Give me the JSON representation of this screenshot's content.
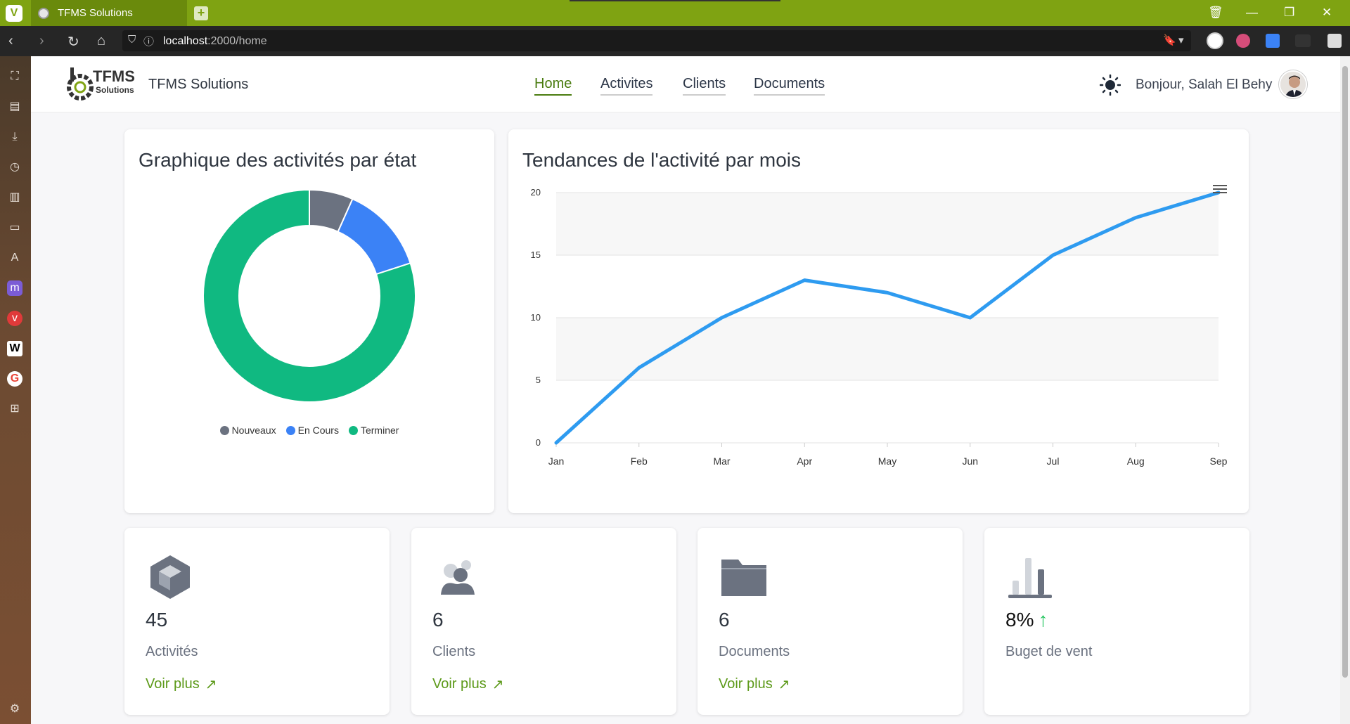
{
  "browser": {
    "tab_title": "TFMS Solutions",
    "url_host": "localhost",
    "url_path": ":2000/home"
  },
  "header": {
    "brand": "TFMS Solutions",
    "logo_text_top": "TFMS",
    "logo_text_bottom": "Solutions",
    "nav": [
      "Home",
      "Activites",
      "Clients",
      "Documents"
    ],
    "active_nav": "Home",
    "greeting": "Bonjour, Salah El Behy"
  },
  "donut": {
    "title": "Graphique des activités par état",
    "legend": [
      "Nouveaux",
      "En Cours",
      "Terminer"
    ]
  },
  "line": {
    "title": "Tendances de l'activité par mois"
  },
  "chart_data": [
    {
      "type": "pie",
      "title": "Graphique des activités par état",
      "categories": [
        "Nouveaux",
        "En Cours",
        "Terminer"
      ],
      "values": [
        3,
        6,
        36
      ],
      "colors": [
        "#6b7280",
        "#3b82f6",
        "#10b981"
      ],
      "legend": "bottom"
    },
    {
      "type": "line",
      "title": "Tendances de l'activité par mois",
      "categories": [
        "Jan",
        "Feb",
        "Mar",
        "Apr",
        "May",
        "Jun",
        "Jul",
        "Aug",
        "Sep"
      ],
      "values": [
        0,
        6,
        10,
        13,
        12,
        10,
        15,
        18,
        20
      ],
      "ylim": [
        0,
        20
      ],
      "yticks": [
        0,
        5,
        10,
        15,
        20
      ],
      "color": "#2e9bf0",
      "grid": true
    }
  ],
  "stats": [
    {
      "value": "45",
      "label": "Activités",
      "link": "Voir plus"
    },
    {
      "value": "6",
      "label": "Clients",
      "link": "Voir plus"
    },
    {
      "value": "6",
      "label": "Documents",
      "link": "Voir plus"
    },
    {
      "value": "8%",
      "label": "Buget de vent",
      "link": ""
    }
  ],
  "colors": {
    "accent": "#4a7c10",
    "link": "#5d9a1a",
    "browser": "#7fa312"
  }
}
